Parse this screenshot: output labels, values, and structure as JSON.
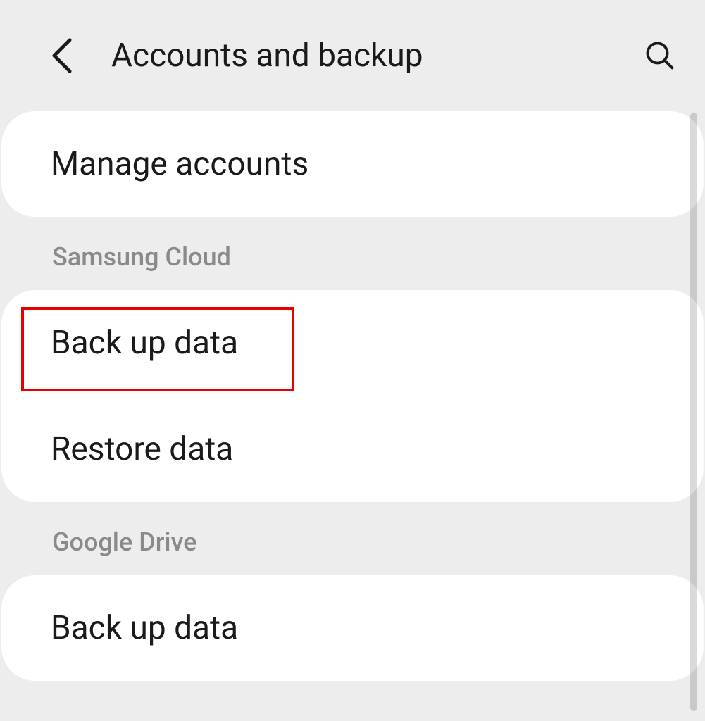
{
  "header": {
    "title": "Accounts and backup"
  },
  "sections": {
    "top": {
      "items": [
        {
          "label": "Manage accounts"
        }
      ]
    },
    "samsung_cloud": {
      "title": "Samsung Cloud",
      "items": [
        {
          "label": "Back up data"
        },
        {
          "label": "Restore data"
        }
      ]
    },
    "google_drive": {
      "title": "Google Drive",
      "items": [
        {
          "label": "Back up data"
        }
      ]
    }
  }
}
